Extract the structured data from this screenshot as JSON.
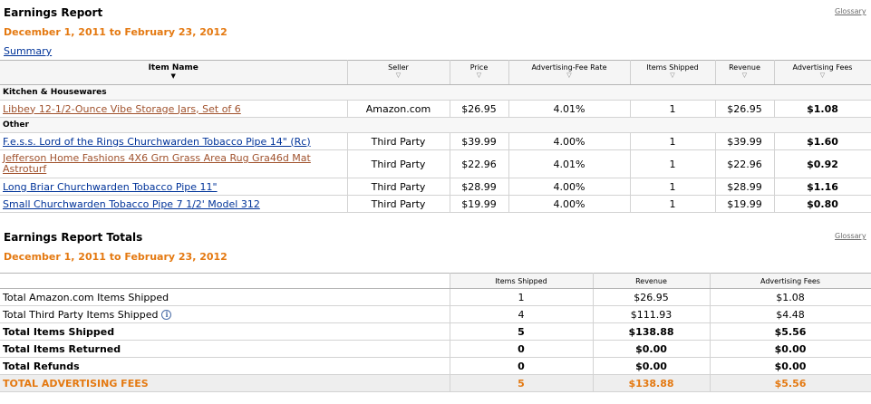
{
  "report": {
    "title": "Earnings Report",
    "date_range": "December 1, 2011 to February 23, 2012",
    "glossary": "Glossary",
    "summary_link": "Summary",
    "columns": [
      "Item Name",
      "Seller",
      "Price",
      "Advertising-Fee Rate",
      "Items Shipped",
      "Revenue",
      "Advertising Fees"
    ],
    "categories": [
      {
        "name": "Kitchen & Housewares",
        "rows": [
          {
            "item": "Libbey 12-1/2-Ounce Vibe Storage Jars, Set of 6",
            "seller": "Amazon.com",
            "price": "$26.95",
            "rate": "4.01%",
            "shipped": "1",
            "revenue": "$26.95",
            "fees": "$1.08"
          }
        ]
      },
      {
        "name": "Other",
        "rows": [
          {
            "item": "F.e.s.s. Lord of the Rings Churchwarden Tobacco Pipe 14\" (Rc)",
            "seller": "Third Party",
            "price": "$39.99",
            "rate": "4.00%",
            "shipped": "1",
            "revenue": "$39.99",
            "fees": "$1.60"
          },
          {
            "item": "Jefferson Home Fashions 4X6 Grn Grass Area Rug Gra46d Mat Astroturf",
            "seller": "Third Party",
            "price": "$22.96",
            "rate": "4.01%",
            "shipped": "1",
            "revenue": "$22.96",
            "fees": "$0.92"
          },
          {
            "item": "Long Briar Churchwarden Tobacco Pipe 11\"",
            "seller": "Third Party",
            "price": "$28.99",
            "rate": "4.00%",
            "shipped": "1",
            "revenue": "$28.99",
            "fees": "$1.16"
          },
          {
            "item": "Small Churchwarden Tobacco Pipe 7 1/2' Model 312",
            "seller": "Third Party",
            "price": "$19.99",
            "rate": "4.00%",
            "shipped": "1",
            "revenue": "$19.99",
            "fees": "$0.80"
          }
        ]
      }
    ]
  },
  "totals": {
    "title": "Earnings Report Totals",
    "date_range": "December 1, 2011 to February 23, 2012",
    "glossary": "Glossary",
    "columns": [
      "Items Shipped",
      "Revenue",
      "Advertising Fees"
    ],
    "rows": [
      {
        "label": "Total Amazon.com Items Shipped",
        "shipped": "1",
        "revenue": "$26.95",
        "fees": "$1.08"
      },
      {
        "label": "Total Third Party Items Shipped",
        "shipped": "4",
        "revenue": "$111.93",
        "fees": "$4.48"
      },
      {
        "label": "Total Items Shipped",
        "shipped": "5",
        "revenue": "$138.88",
        "fees": "$5.56"
      },
      {
        "label": "Total Items Returned",
        "shipped": "0",
        "revenue": "$0.00",
        "fees": "$0.00"
      },
      {
        "label": "Total Refunds",
        "shipped": "0",
        "revenue": "$0.00",
        "fees": "$0.00"
      },
      {
        "label": "TOTAL ADVERTISING FEES",
        "shipped": "5",
        "revenue": "$138.88",
        "fees": "$5.56"
      }
    ]
  },
  "icons": {
    "sort": "sort-arrow-icon",
    "info": "info-icon"
  },
  "colors": {
    "accent": "#e47911",
    "link": "#003399",
    "item_link": "#a0522d"
  }
}
